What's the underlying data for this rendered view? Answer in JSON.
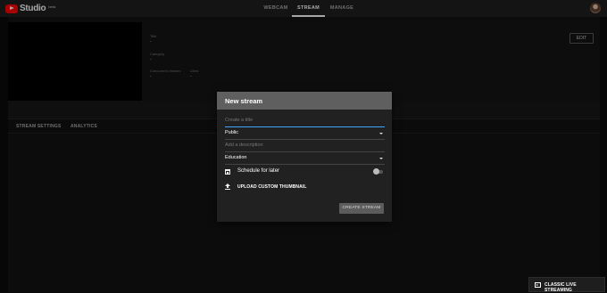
{
  "app": {
    "logo_text": "Studio",
    "logo_badge": "beta",
    "icon": "youtube-play-icon"
  },
  "nav": {
    "tabs": [
      {
        "label": "WEBCAM",
        "active": false
      },
      {
        "label": "STREAM",
        "active": true
      },
      {
        "label": "MANAGE",
        "active": false
      }
    ]
  },
  "stream_info": {
    "title_label": "Title",
    "title_value": "-",
    "category_label": "Category",
    "category_value": "-",
    "viewers_label": "Concurrent viewers",
    "viewers_value": "-",
    "likes_label": "Likes",
    "likes_value": "-",
    "edit_label": "EDIT"
  },
  "subtabs": [
    {
      "label": "STREAM SETTINGS"
    },
    {
      "label": "ANALYTICS"
    }
  ],
  "modal": {
    "title": "New stream",
    "title_placeholder": "Create a title",
    "visibility_value": "Public",
    "description_placeholder": "Add a description",
    "category_value": "Education",
    "schedule_label": "Schedule for later",
    "schedule_enabled": false,
    "upload_label": "UPLOAD CUSTOM THUMBNAIL",
    "create_label": "CREATE STREAM"
  },
  "footer": {
    "classic_label": "CLASSIC LIVE STREAMING"
  },
  "colors": {
    "brand_red": "#ff0000",
    "focus_blue": "#3ea6ff",
    "modal_header": "#5f5f5f"
  }
}
